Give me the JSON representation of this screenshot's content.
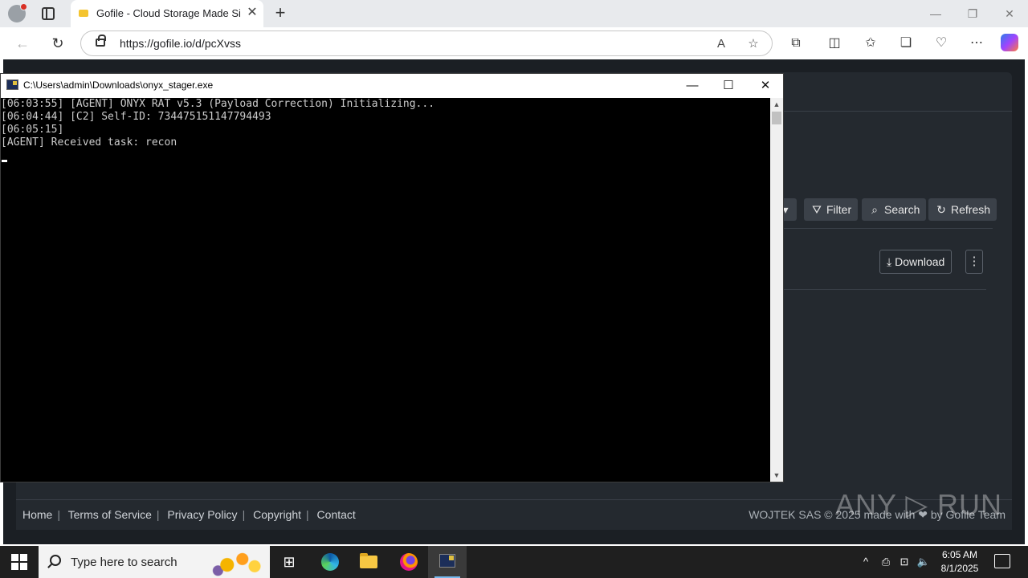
{
  "browser": {
    "tab_title": "Gofile - Cloud Storage Made Simple",
    "tab_close": "✕",
    "new_tab": "+",
    "url": "https://gofile.io/d/pcXvss",
    "window_controls": {
      "minimize": "—",
      "restore": "❐",
      "close": "✕"
    },
    "toolbar_icons": [
      "read-aloud-icon",
      "favorite-star-icon",
      "extensions-icon",
      "split-screen-icon",
      "favorites-icon",
      "collections-icon",
      "browser-essentials-icon",
      "more-icon",
      "copilot-icon"
    ]
  },
  "page": {
    "buttons": {
      "filter": "Filter",
      "search": "Search",
      "refresh": "Refresh",
      "download": "Download",
      "more": "⋮"
    },
    "footer": {
      "links": [
        "Home",
        "Terms of Service",
        "Privacy Policy",
        "Copyright",
        "Contact"
      ],
      "right_text": "WOJTEK SAS © 2025 made with ❤ by Gofile Team"
    },
    "watermark": "ANY ▷ RUN"
  },
  "console": {
    "title": "C:\\Users\\admin\\Downloads\\onyx_stager.exe",
    "lines": [
      "[06:03:55] [AGENT] ONYX RAT v5.3 (Payload Correction) Initializing...",
      "[06:04:44] [C2] Self-ID: 734475151147794493",
      "[06:05:15]",
      "[AGENT] Received task: recon"
    ],
    "controls": {
      "minimize": "—",
      "maximize": "☐",
      "close": "✕"
    }
  },
  "taskbar": {
    "search_placeholder": "Type here to search",
    "time": "6:05 AM",
    "date": "8/1/2025",
    "apps": [
      "task-view-icon",
      "edge-icon",
      "file-explorer-icon",
      "firefox-icon",
      "console-app-icon"
    ],
    "active_app": "console-app-icon"
  }
}
